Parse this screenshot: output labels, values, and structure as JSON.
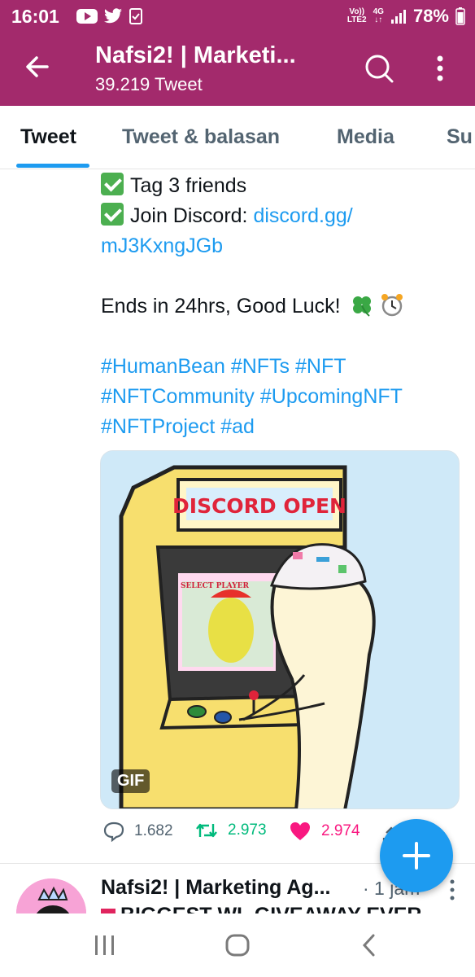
{
  "status_bar": {
    "time": "16:01",
    "network_top": "Vo))",
    "network_bottom": "LTE2",
    "net_type": "4G",
    "battery": "78%",
    "icons": [
      "youtube-icon",
      "twitter-icon",
      "download-check-icon",
      "signal-icon",
      "battery-icon"
    ]
  },
  "header": {
    "title": "Nafsi2! | Marketi...",
    "subtitle": "39.219 Tweet",
    "colors": {
      "bar": "#a32a6c"
    }
  },
  "tabs": [
    {
      "label": "Tweet",
      "active": true
    },
    {
      "label": "Tweet & balasan",
      "active": false
    },
    {
      "label": "Media",
      "active": false
    },
    {
      "label": "Su",
      "active": false
    }
  ],
  "tweet": {
    "line1": "Tag 3 friends",
    "line2_text": "Join Discord: ",
    "line2_link": "discord.gg/",
    "line3_link": "mJ3KxngJGb",
    "line4": "Ends in 24hrs, Good Luck!",
    "hashtags_line1": "#HumanBean #NFTs #NFT",
    "hashtags_line2": "#NFTCommunity #UpcomingNFT",
    "hashtags_line3": "#NFTProject #ad",
    "media": {
      "sign_text": "DISCORD OPEN",
      "screen_text": "SELECT PLAYER",
      "badge": "GIF"
    },
    "actions": {
      "replies": "1.682",
      "retweets": "2.973",
      "likes": "2.974"
    }
  },
  "next_tweet": {
    "name": "Nafsi2! | Marketing Ag...",
    "time": "· 1 jam",
    "text": "BIGGEST WL GIVEAWAY EVER"
  },
  "colors": {
    "accent": "#1d9bf0",
    "retweet": "#00ba7c",
    "like": "#f91880"
  }
}
